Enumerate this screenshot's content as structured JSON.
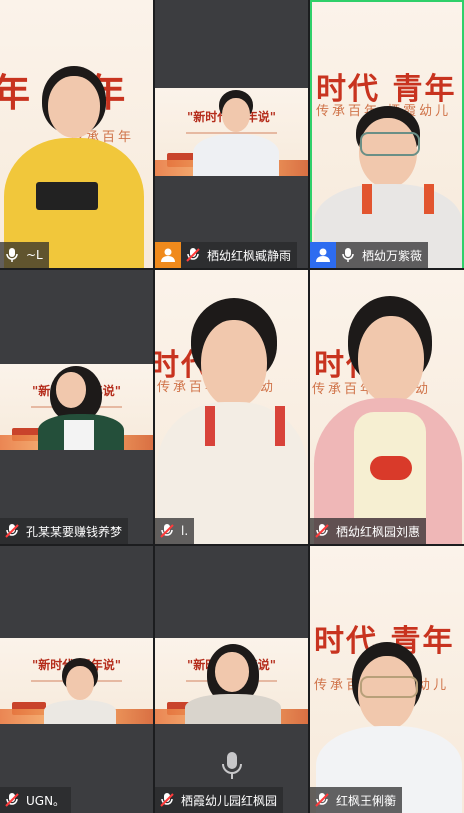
{
  "participants": [
    {
      "name": "~L",
      "mic": "on",
      "avatar_icon": "none"
    },
    {
      "name": "栖幼红枫臧静雨",
      "mic": "muted",
      "avatar_icon": "orange-person-icon"
    },
    {
      "name": "栖幼万紫薇",
      "mic": "on",
      "avatar_icon": "blue-person-icon"
    },
    {
      "name": "孔某某要赚钱养梦",
      "mic": "muted",
      "avatar_icon": "none"
    },
    {
      "name": "l.",
      "mic": "muted",
      "avatar_icon": "none"
    },
    {
      "name": "栖幼红枫园刘惠",
      "mic": "muted",
      "avatar_icon": "none"
    },
    {
      "name": "UGN。",
      "mic": "muted",
      "avatar_icon": "none"
    },
    {
      "name": "栖霞幼儿园红枫园",
      "mic": "muted",
      "avatar_icon": "none"
    },
    {
      "name": "红枫王俐蘅",
      "mic": "muted",
      "avatar_icon": "none"
    }
  ],
  "colors": {
    "active_speaker_border": "#2fd06a",
    "poster_red": "#c8331f",
    "label_bg": "#28282a"
  }
}
